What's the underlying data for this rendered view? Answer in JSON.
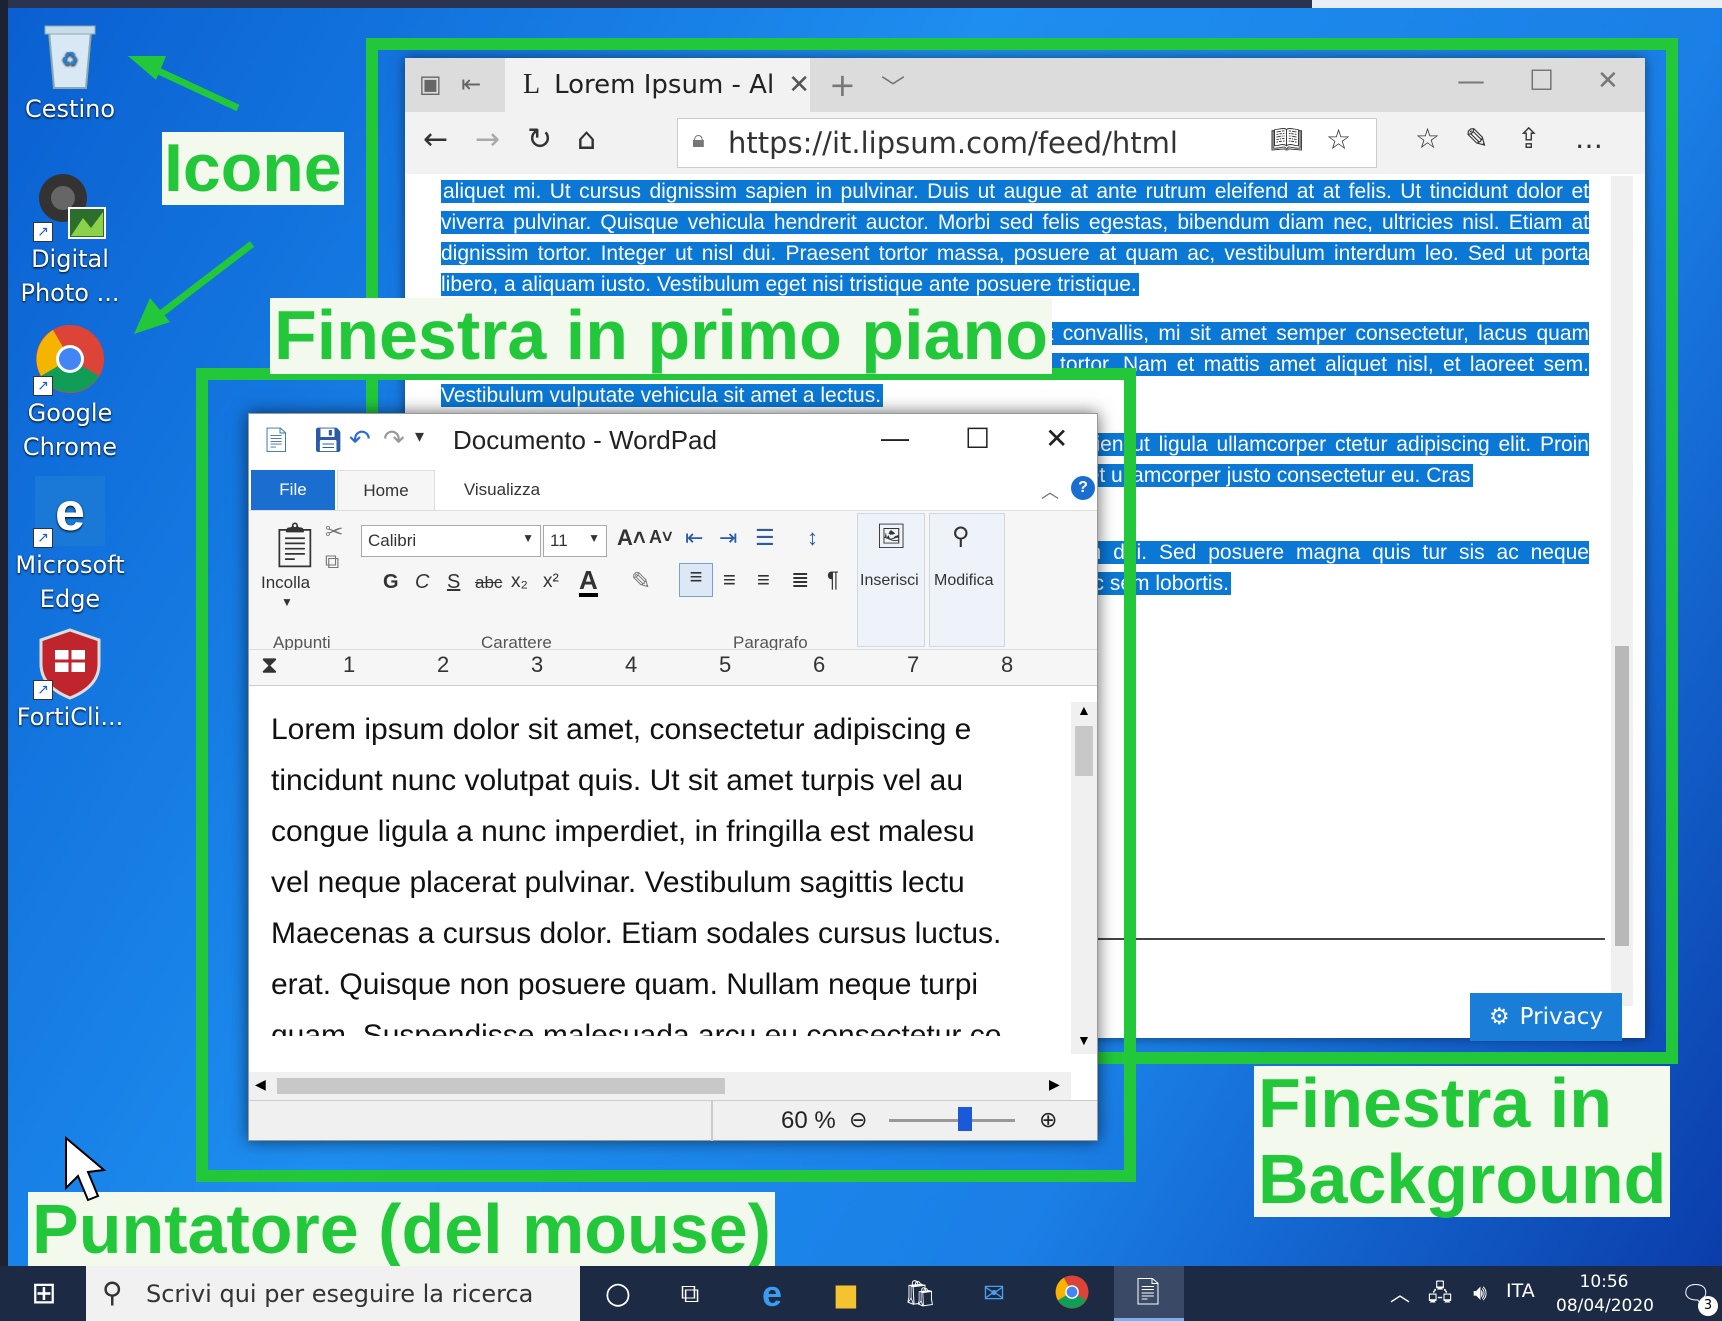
{
  "desktop_icons": [
    {
      "label": "Cestino",
      "icon": "recycle-bin-icon"
    },
    {
      "label": "Digital Photo ...",
      "icon": "digital-photo-icon"
    },
    {
      "label": "Google Chrome",
      "icon": "chrome-icon"
    },
    {
      "label": "Microsoft Edge",
      "icon": "edge-icon"
    },
    {
      "label": "FortiCli...",
      "icon": "forticlient-icon"
    }
  ],
  "annotations": {
    "icone": "Icone",
    "foreground": "Finestra in primo piano",
    "background_line1": "Finestra in",
    "background_line2": "Background",
    "pointer": "Puntatore (del mouse)",
    "color": "#22c83a"
  },
  "edge": {
    "tab_title": "Lorem Ipsum - Al",
    "tab_favicon": "L",
    "url": "https://it.lipsum.com/feed/html",
    "privacy": "Privacy",
    "paragraphs": [
      "aliquet mi. Ut cursus dignissim sapien in pulvinar. Duis ut augue at ante rutrum eleifend at at felis. Ut tincidunt dolor et viverra pulvinar. Quisque vehicula hendrerit auctor. Morbi sed felis egestas, bibendum diam nec, ultricies nisl. Etiam at dignissim tortor. Integer ut nisl dui. Praesent tortor massa, posuere at quam ac, vestibulum interdum leo. Sed ut porta libero, a aliquam iusto. Vestibulum eget nisi tristique ante posuere tristique.",
      "sit amet hendrerit. Maecenas sit amet quam at nunc. Praesent convallis, mi sit amet semper consectetur, lacus quam ultrices nibh, sit amet aliquet eros est at urna. Cras quis porta tortor. Nam et mattis amet aliquet nisl, et laoreet sem. Vestibulum vulputate vehicula sit amet a lectus.",
      "rius ultrices, euismod libero ac, laoreet eros. tur leo. Aenean id sapien ut ligula ullamcorper ctetur adipiscing elit. Proin malesuada est et , vitae congue nisi sodales. Vestibulum placerat est et ullamcorper justo consectetur eu. Cras",
      "gula. Integer porta elit commodo sapien lobortis o. In vitae lorem dui. Sed posuere magna quis tur sis ac neque pellentesque, sed congue mi luctus molestie et at justo. Vestibulum nec sem lobortis."
    ]
  },
  "wordpad": {
    "title": "Documento - WordPad",
    "tabs": [
      "File",
      "Home",
      "Visualizza"
    ],
    "paste": "Incolla",
    "font_name": "Calibri",
    "font_size": "11",
    "format_labels": [
      "G",
      "C",
      "S",
      "abc",
      "x₂",
      "x²"
    ],
    "insert": "Inserisci",
    "edit": "Modifica",
    "groups": [
      "Appunti",
      "Carattere",
      "Paragrafo"
    ],
    "ruler_marks": [
      "1",
      "2",
      "3",
      "4",
      "5",
      "6",
      "7",
      "8"
    ],
    "lines": [
      "Lorem ipsum dolor sit amet, consectetur adipiscing e",
      "tincidunt nunc volutpat quis. Ut sit amet turpis vel au",
      "congue ligula a nunc imperdiet, in fringilla est malesu",
      "vel neque placerat pulvinar. Vestibulum sagittis lectu",
      "Maecenas a cursus dolor. Etiam sodales cursus luctus.",
      "erat. Quisque non posuere quam. Nullam neque turpi",
      "quam. Suspendisse malesuada arcu eu consectetur co"
    ],
    "zoom": "60 %",
    "zoom_level": 0.6
  },
  "taskbar": {
    "search_placeholder": "Scrivi qui per eseguire la ricerca",
    "lang": "ITA",
    "time": "10:56",
    "date": "08/04/2020",
    "notifications": "3"
  }
}
